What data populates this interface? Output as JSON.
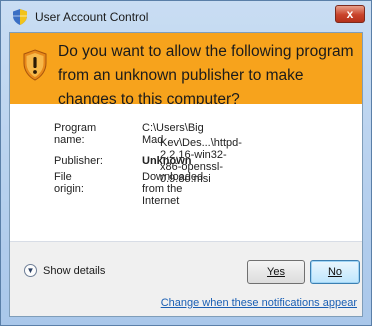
{
  "window": {
    "title": "User Account Control",
    "close_label": "x"
  },
  "banner": {
    "question": "Do you want to allow the following program from an unknown publisher to make changes to this computer?",
    "color": "#f7a31c"
  },
  "details": {
    "program_name_label": "Program name:",
    "program_name_line1": "C:\\Users\\Big Mad",
    "program_name_line2": "Kev\\Des...\\httpd-2.2.16-win32-x86-openssl-0.9.8o.msi",
    "publisher_label": "Publisher:",
    "publisher_value": "Unknown",
    "file_origin_label": "File origin:",
    "file_origin_value": "Downloaded from the Internet"
  },
  "footer": {
    "show_details_label": "Show details",
    "yes_label": "Yes",
    "no_label": "No",
    "notifications_link": "Change when these notifications appear"
  }
}
